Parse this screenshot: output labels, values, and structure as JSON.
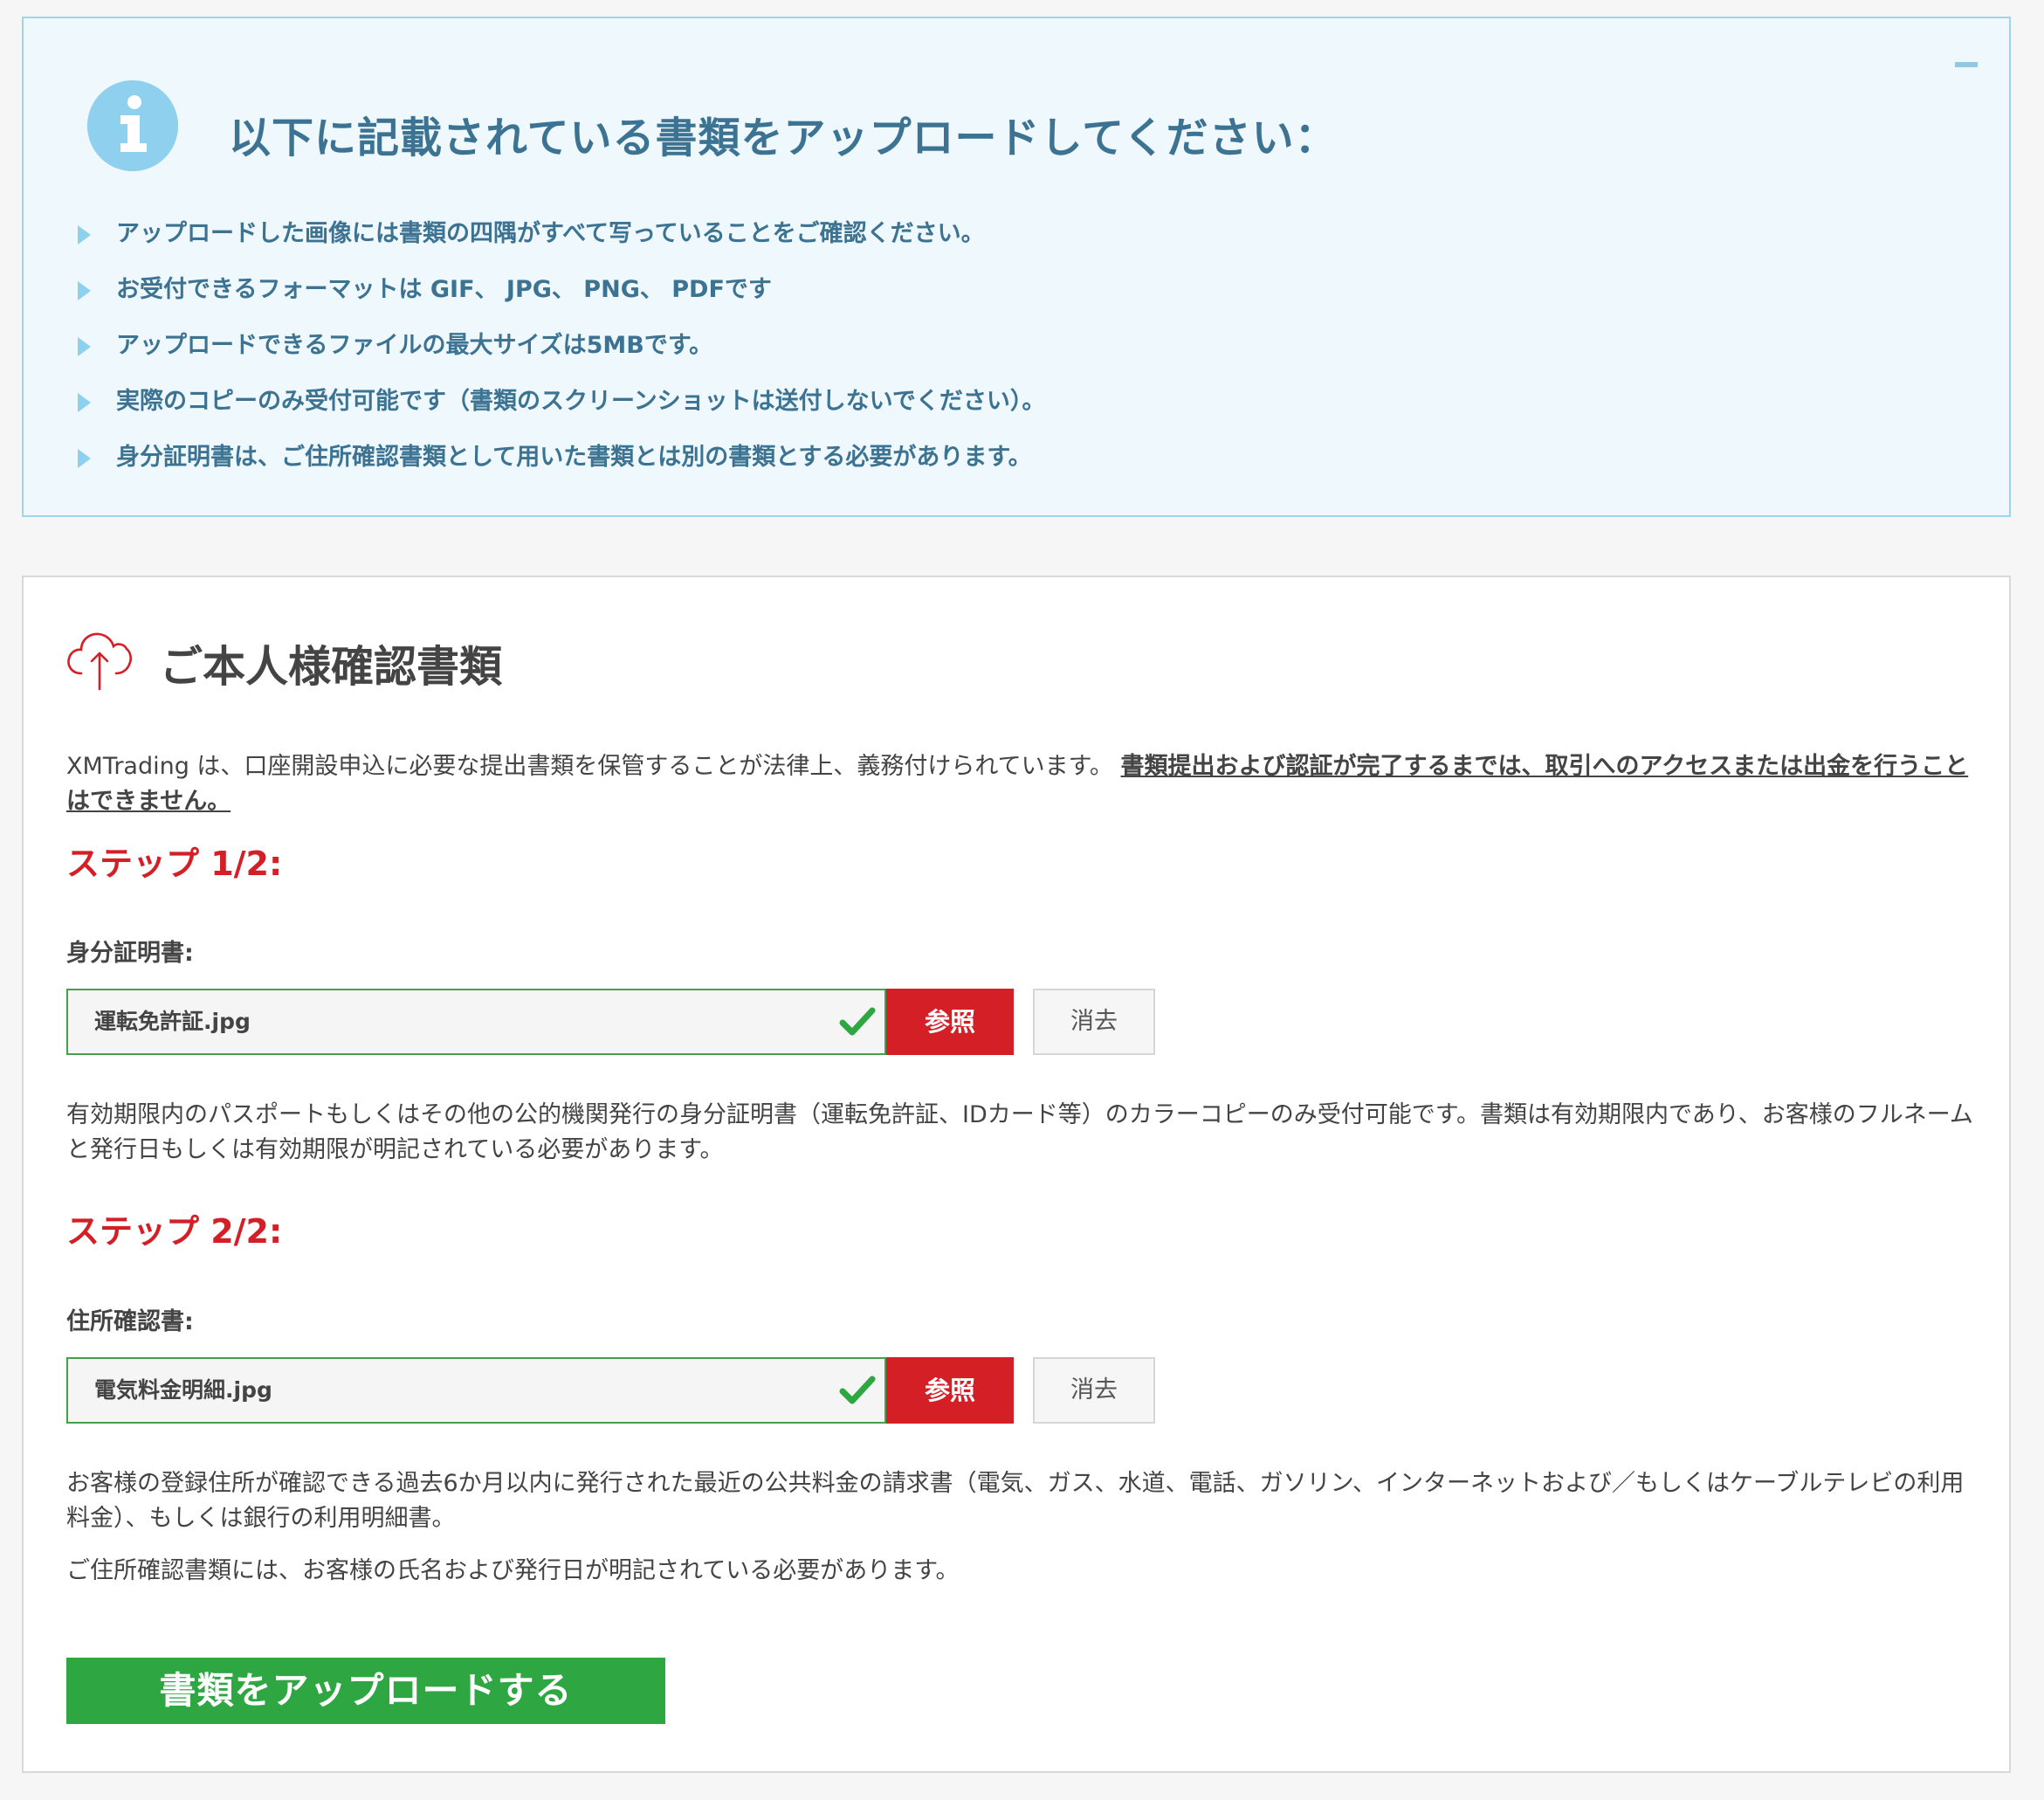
{
  "info": {
    "title": "以下に記載されている書類をアップロードしてください：",
    "items": [
      "アップロードした画像には書類の四隅がすべて写っていることをご確認ください。",
      "お受付できるフォーマットは GIF、 JPG、 PNG、 PDFです",
      "アップロードできるファイルの最大サイズは5MBです。",
      "実際のコピーのみ受付可能です（書類のスクリーンショットは送付しないでください）。",
      "身分証明書は、ご住所確認書類として用いた書類とは別の書類とする必要があります。"
    ]
  },
  "panel": {
    "title": "ご本人様確認書類",
    "intro_text": "XMTrading は、口座開設申込に必要な提出書類を保管することが法律上、義務付けられています。 ",
    "intro_underlined": "書類提出および認証が完了するまでは、取引へのアクセスまたは出金を行うことはできません。"
  },
  "step1": {
    "title": "ステップ 1/2:",
    "label": "身分証明書:",
    "file_name": "運転免許証.jpg",
    "browse_label": "参照",
    "clear_label": "消去",
    "description": "有効期限内のパスポートもしくはその他の公的機関発行の身分証明書（運転免許証、IDカード等）のカラーコピーのみ受付可能です。書類は有効期限内であり、お客様のフルネームと発行日もしくは有効期限が明記されている必要があります。"
  },
  "step2": {
    "title": "ステップ 2/2:",
    "label": "住所確認書:",
    "file_name": "電気料金明細.jpg",
    "browse_label": "参照",
    "clear_label": "消去",
    "description": "お客様の登録住所が確認できる過去6か月以内に発行された最近の公共料金の請求書（電気、ガス、水道、電話、ガソリン、インターネットおよび／もしくはケーブルテレビの利用料金）、もしくは銀行の利用明細書。",
    "note": "ご住所確認書類には、お客様の氏名および発行日が明記されている必要があります。"
  },
  "upload_button": "書類をアップロードする",
  "colors": {
    "info_bg": "#eff8fd",
    "info_text": "#3d7392",
    "accent_red": "#d51f27",
    "success_green": "#2ea743"
  },
  "icons": {
    "info": "info-icon",
    "collapse": "minus-icon",
    "bullet": "triangle-right-icon",
    "section": "cloud-upload-icon",
    "valid": "check-icon"
  }
}
